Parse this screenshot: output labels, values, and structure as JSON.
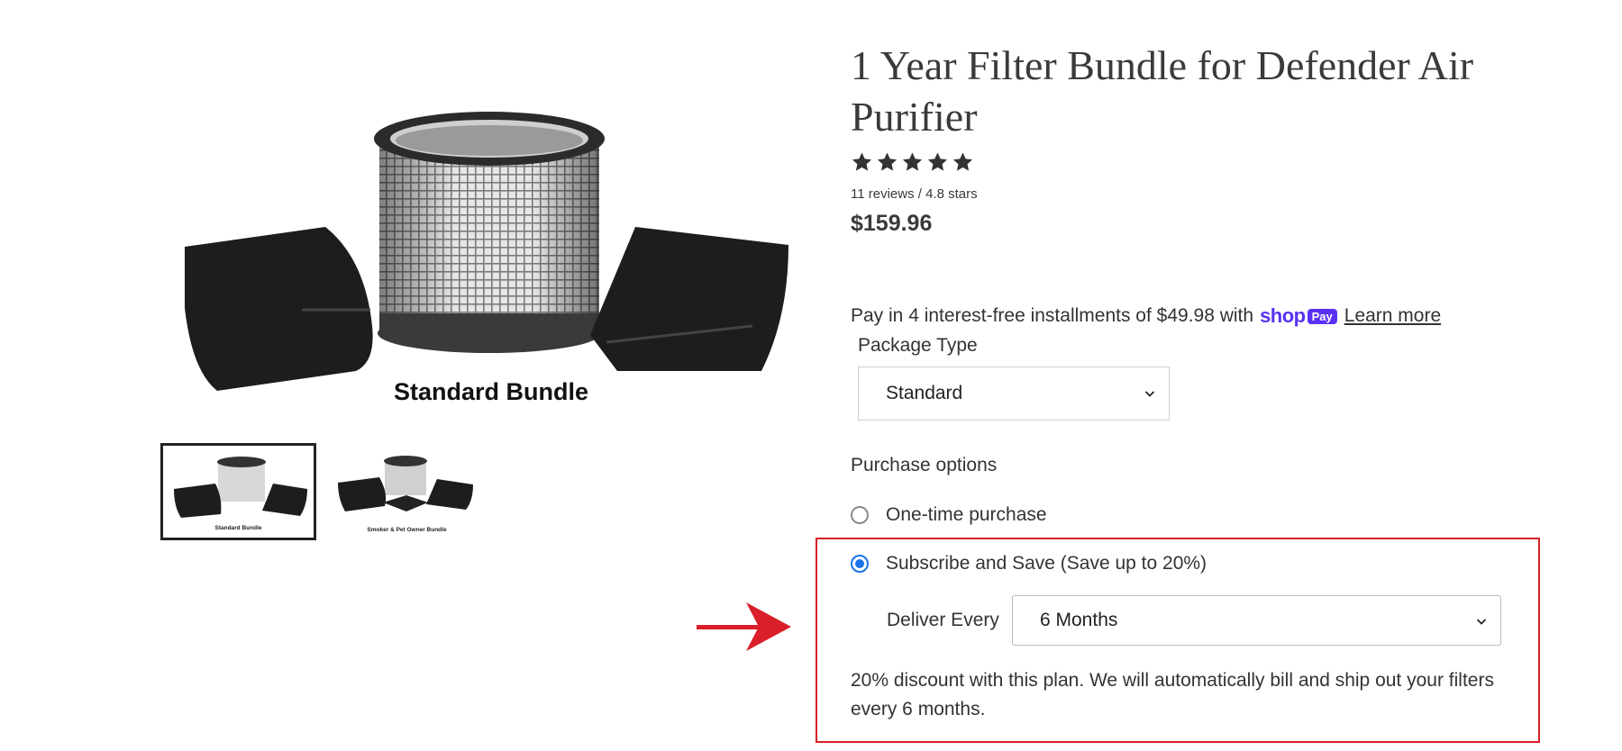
{
  "gallery": {
    "main_caption": "Standard Bundle",
    "thumbnails": [
      {
        "caption": "Standard Bundle",
        "active": true
      },
      {
        "caption": "Smoker & Pet Owner Bundle",
        "active": false
      }
    ]
  },
  "product": {
    "title": "1 Year Filter Bundle for Defender Air Purifier",
    "rating": 4.8,
    "rating_max": 5,
    "reviews_text": "11 reviews / 4.8 stars",
    "price": "$159.96"
  },
  "installments": {
    "text": "Pay in 4 interest-free installments of $49.98 with",
    "shop_word": "shop",
    "pay_badge": "Pay",
    "learn_more": "Learn more",
    "brand_color": "#5a31f4"
  },
  "package": {
    "label": "Package Type",
    "selected": "Standard"
  },
  "purchase": {
    "label": "Purchase options",
    "options": [
      {
        "label": "One-time purchase",
        "checked": false
      },
      {
        "label": "Subscribe and Save (Save up to 20%)",
        "checked": true
      }
    ],
    "deliver_label": "Deliver Every",
    "deliver_selected": "6 Months",
    "plan_description": "20% discount with this plan. We will automatically bill and ship out your filters every 6 months."
  },
  "annotation": {
    "color": "#d91f2a",
    "arrow_icon": "arrow-right-icon"
  }
}
